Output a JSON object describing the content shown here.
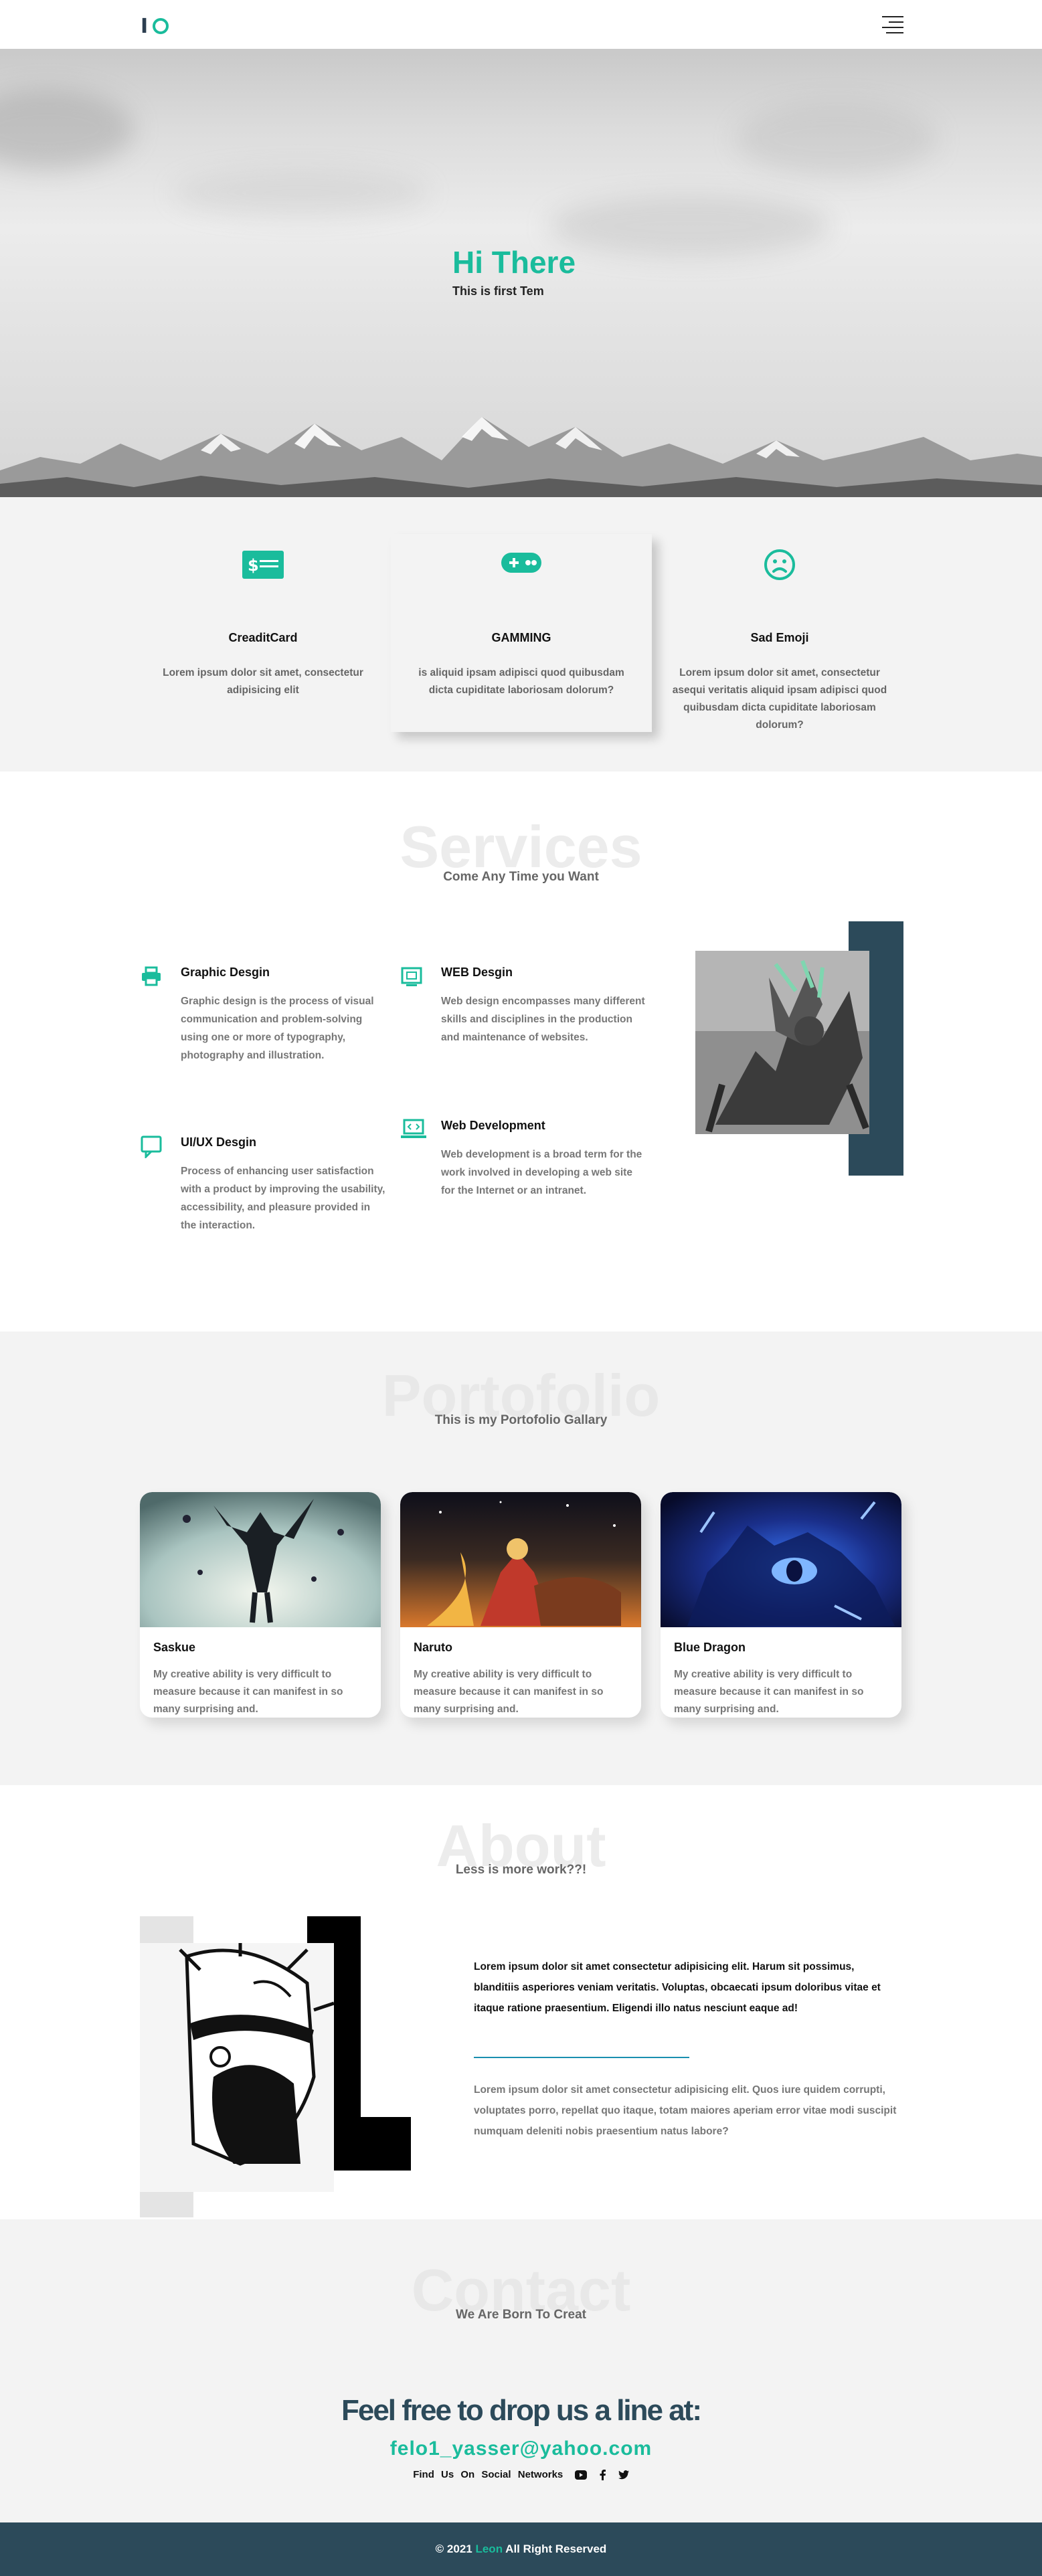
{
  "header": {
    "logo_text": "I",
    "menu_icon": "hamburger-menu-icon"
  },
  "hero": {
    "title": "Hi There",
    "subtitle": "This is first Tem"
  },
  "features": [
    {
      "icon": "credit-card-icon",
      "title": "CreaditCard",
      "text": "Lorem ipsum dolor sit amet, consectetur adipisicing elit"
    },
    {
      "icon": "gamepad-icon",
      "title": "GAMMING",
      "text": "is aliquid ipsam adipisci quod quibusdam dicta cupiditate laboriosam dolorum?"
    },
    {
      "icon": "sad-emoji-icon",
      "title": "Sad Emoji",
      "text": "Lorem ipsum dolor sit amet, consectetur asequi veritatis aliquid ipsam adipisci quod quibusdam dicta cupiditate laboriosam dolorum?"
    }
  ],
  "services": {
    "bg_title": "Services",
    "subtitle": "Come Any Time you Want",
    "items": [
      {
        "icon": "printer-icon",
        "title": "Graphic Desgin",
        "text": "Graphic design is the process of visual communication and problem-solving using one or more of typography, photography and illustration."
      },
      {
        "icon": "monitor-chat-icon",
        "title": "UI/UX Desgin",
        "text": "Process of enhancing user satisfaction with a product by improving the usability, accessibility, and pleasure provided in the interaction."
      },
      {
        "icon": "web-design-icon",
        "title": "WEB Desgin",
        "text": "Web design encompasses many different skills and disciplines in the production and maintenance of websites."
      },
      {
        "icon": "code-laptop-icon",
        "title": "Web Development",
        "text": "Web development is a broad term for the work involved in developing a web site for the Internet or an intranet."
      }
    ]
  },
  "portfolio": {
    "bg_title": "Portofolio",
    "subtitle": "This is my Portofolio Gallary",
    "cards": [
      {
        "title": "Saskue",
        "text": "My creative ability is very difficult to measure because it can manifest in so many surprising and."
      },
      {
        "title": "Naruto",
        "text": "My creative ability is very difficult to measure because it can manifest in so many surprising and."
      },
      {
        "title": "Blue Dragon",
        "text": "My creative ability is very difficult to measure because it can manifest in so many surprising and."
      }
    ]
  },
  "about": {
    "bg_title": "About",
    "subtitle": "Less is more work??!",
    "para1": "Lorem ipsum dolor sit amet consectetur adipisicing elit. Harum sit possimus, blanditiis asperiores veniam veritatis. Voluptas, obcaecati ipsum doloribus vitae et itaque ratione praesentium. Eligendi illo natus nesciunt eaque ad!",
    "para2": "Lorem ipsum dolor sit amet consectetur adipisicing elit. Quos iure quidem corrupti, voluptates porro, repellat quo itaque, totam maiores aperiam error vitae modi suscipit numquam deleniti nobis praesentium natus labore?"
  },
  "contact": {
    "bg_title": "Contact",
    "subtitle": "We Are Born To Creat",
    "headline": "Feel free to drop us a line at:",
    "email": "felo1_yasser@yahoo.com",
    "social_label": "Find Us On Social Networks"
  },
  "footer": {
    "prefix": "© 2021",
    "name": "Leon",
    "suffix": "All Right Reserved"
  },
  "colors": {
    "accent": "#1abc9c",
    "dark": "#2c4a5a"
  }
}
